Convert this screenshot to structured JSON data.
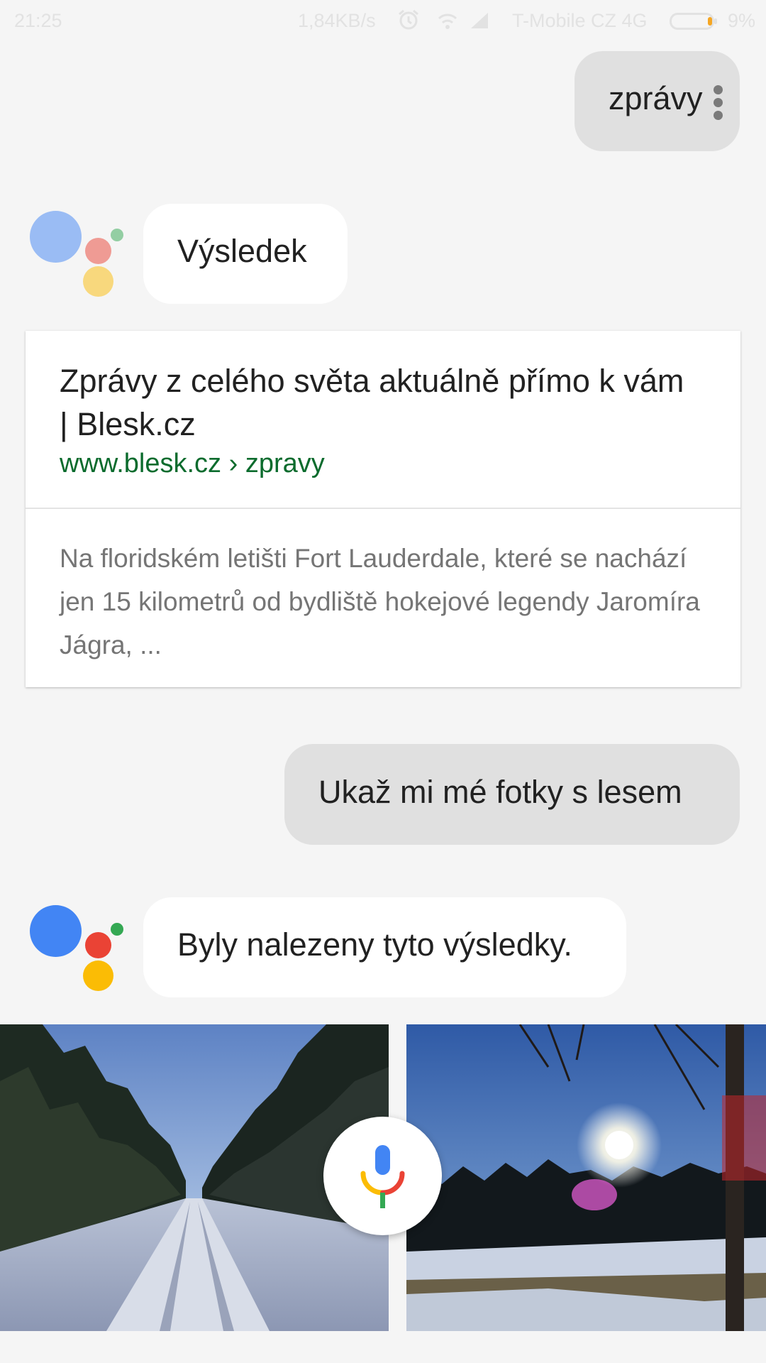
{
  "status_bar": {
    "time": "21:25",
    "speed": "1,84KB/s",
    "carrier": "T-Mobile CZ 4G",
    "battery": "9%",
    "icons": [
      "alarm-icon",
      "wifi-icon",
      "signal-icon",
      "battery-icon"
    ]
  },
  "conversation": {
    "query_1": "zprávy",
    "reply_1": "Výsledek",
    "result": {
      "title": "Zprávy z celého světa aktuálně přímo k vám | Blesk.cz",
      "url": "www.blesk.cz › zpravy",
      "snippet": "Na floridském letišti Fort Lauderdale, které se nachází jen 15 kilometrů od bydliště hokejové legendy Jaromíra Jágra, ..."
    },
    "query_2": "Ukaž mi mé fotky s lesem",
    "reply_2": "Byly nalezeny tyto výsledky."
  },
  "photos": [
    {
      "subject": "snowy forest road"
    },
    {
      "subject": "sun over winter forest"
    }
  ],
  "colors": {
    "background": "#f5f5f5",
    "user_bubble": "#e0e0e0",
    "assistant_bubble": "#ffffff",
    "url_green": "#0b6b2d",
    "google_blue": "#4285f4",
    "google_red": "#ea4335",
    "google_yellow": "#fbbc05",
    "google_green": "#34a853"
  }
}
